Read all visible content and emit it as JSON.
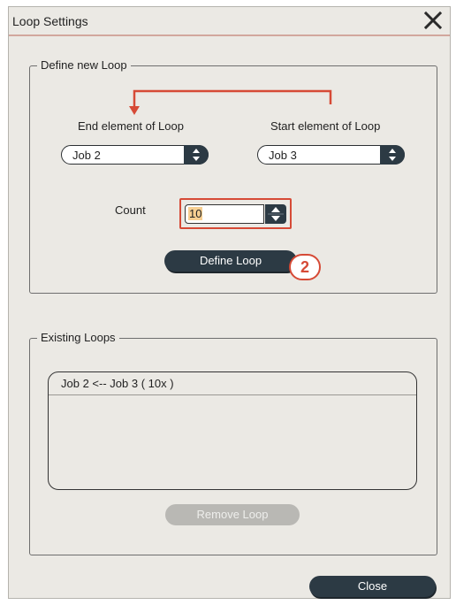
{
  "window": {
    "title": "Loop Settings"
  },
  "define_group": {
    "legend": "Define new Loop",
    "end_label": "End element of Loop",
    "start_label": "Start element of Loop",
    "end_value": "Job 2",
    "start_value": "Job 3",
    "count_label": "Count",
    "count_value": "10",
    "define_button": "Define Loop",
    "callout_number": "2"
  },
  "existing_group": {
    "legend": "Existing Loops",
    "loops": [
      "Job 2 <-- Job 3 ( 10x )"
    ],
    "remove_button": "Remove Loop"
  },
  "footer": {
    "close_button": "Close"
  },
  "colors": {
    "accent_red": "#d64a36",
    "button_dark": "#2c3a44",
    "window_bg": "#ebe9e4"
  },
  "icons": [
    "close-icon",
    "up-down-arrow-icon",
    "spinner-arrows-icon",
    "loop-direction-arrow-icon"
  ]
}
